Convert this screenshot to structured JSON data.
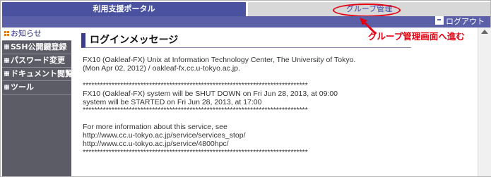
{
  "tabs": {
    "active_label": "利用支援ポータル",
    "inactive_label": "グループ管理"
  },
  "header": {
    "logout_label": "ログアウト"
  },
  "sidebar": {
    "items": [
      {
        "label": "お知らせ"
      },
      {
        "label": "SSH公開鍵登録"
      },
      {
        "label": "パスワード変更"
      },
      {
        "label": "ドキュメント閲覧"
      },
      {
        "label": "ツール"
      }
    ]
  },
  "main": {
    "title": "ログインメッセージ",
    "message": "FX10 (Oakleaf-FX) Unix at Information Technology Center, The University of Tokyo.\n(Mon Apr 02, 2012) / oakleaf-fx.cc.u-tokyo.ac.jp.\n\n******************************************************************************\nFX10 (Oakleaf-FX) system will be SHUT DOWN on Fri Jun 28, 2013, at 09:00\nsystem will be STARTED on Fri Jun 28, 2013, at 17:00\n******************************************************************************\n\nFor more information about this service, see\nhttp://www.cc.u-tokyo.ac.jp/service/services_stop/\nhttp://www.cc.u-tokyo.ac.jp/service/4800hpc/\n******************************************************************************"
  },
  "annotation": {
    "text": "グループ管理画面へ進む",
    "color": "#e60012"
  }
}
